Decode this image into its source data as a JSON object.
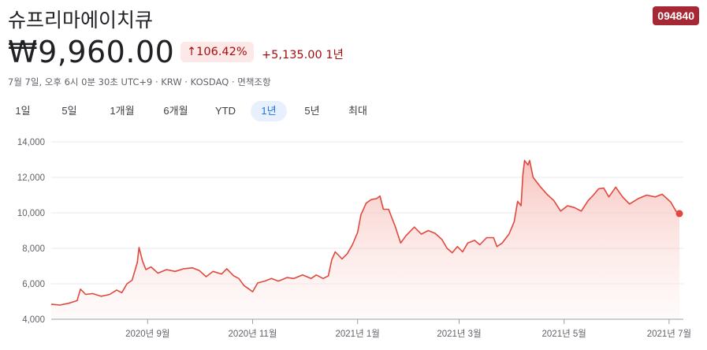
{
  "header": {
    "title": "슈프리마에이치큐",
    "ticker": "094840",
    "price": "₩9,960.00",
    "change_pct": "↑106.42%",
    "change_abs": "+5,135.00 1년",
    "meta": "7월 7일, 오후 6시 0분 30초 UTC+9 · KRW · KOSDAQ · 면책조항"
  },
  "tabs": [
    "1일",
    "5일",
    "1개월",
    "6개월",
    "YTD",
    "1년",
    "5년",
    "최대"
  ],
  "active_tab": "1년",
  "colors": {
    "line": "#e0483e",
    "fill": "#fbe3e1",
    "accent": "#1a73e8",
    "down": "#a50e0e"
  },
  "chart_data": {
    "type": "area",
    "title": "",
    "xlabel": "",
    "ylabel": "",
    "ylim": [
      4000,
      14000
    ],
    "yticks": [
      4000,
      6000,
      8000,
      10000,
      12000,
      14000
    ],
    "ytick_labels": [
      "4,000",
      "6,000",
      "8,000",
      "10,000",
      "12,000",
      "14,000"
    ],
    "xticks": [
      "2020-09-01",
      "2020-11-01",
      "2021-01-01",
      "2021-03-01",
      "2021-05-01",
      "2021-07-01"
    ],
    "xtick_labels": [
      "2020년 9월",
      "2020년 11월",
      "2021년 1월",
      "2021년 3월",
      "2021년 5월",
      "2021년 7월"
    ],
    "x_range": [
      "2020-07-07",
      "2021-07-07"
    ],
    "grid": true,
    "series": [
      {
        "name": "",
        "points": [
          [
            "2020-07-07",
            4850
          ],
          [
            "2020-07-12",
            4800
          ],
          [
            "2020-07-17",
            4900
          ],
          [
            "2020-07-22",
            5050
          ],
          [
            "2020-07-24",
            5700
          ],
          [
            "2020-07-27",
            5400
          ],
          [
            "2020-07-31",
            5450
          ],
          [
            "2020-08-05",
            5300
          ],
          [
            "2020-08-10",
            5400
          ],
          [
            "2020-08-14",
            5650
          ],
          [
            "2020-08-17",
            5500
          ],
          [
            "2020-08-20",
            6000
          ],
          [
            "2020-08-23",
            6200
          ],
          [
            "2020-08-26",
            7200
          ],
          [
            "2020-08-27",
            8050
          ],
          [
            "2020-08-29",
            7300
          ],
          [
            "2020-08-31",
            6800
          ],
          [
            "2020-09-03",
            6950
          ],
          [
            "2020-09-07",
            6600
          ],
          [
            "2020-09-12",
            6800
          ],
          [
            "2020-09-17",
            6700
          ],
          [
            "2020-09-22",
            6850
          ],
          [
            "2020-09-27",
            6900
          ],
          [
            "2020-10-01",
            6750
          ],
          [
            "2020-10-05",
            6400
          ],
          [
            "2020-10-09",
            6700
          ],
          [
            "2020-10-14",
            6550
          ],
          [
            "2020-10-17",
            6850
          ],
          [
            "2020-10-21",
            6450
          ],
          [
            "2020-10-24",
            6300
          ],
          [
            "2020-10-27",
            5900
          ],
          [
            "2020-10-30",
            5700
          ],
          [
            "2020-11-01",
            5550
          ],
          [
            "2020-11-04",
            6050
          ],
          [
            "2020-11-08",
            6150
          ],
          [
            "2020-11-12",
            6300
          ],
          [
            "2020-11-16",
            6150
          ],
          [
            "2020-11-21",
            6350
          ],
          [
            "2020-11-25",
            6300
          ],
          [
            "2020-11-30",
            6500
          ],
          [
            "2020-12-05",
            6300
          ],
          [
            "2020-12-08",
            6500
          ],
          [
            "2020-12-12",
            6300
          ],
          [
            "2020-12-15",
            6450
          ],
          [
            "2020-12-17",
            7350
          ],
          [
            "2020-12-19",
            7800
          ],
          [
            "2020-12-21",
            7600
          ],
          [
            "2020-12-23",
            7400
          ],
          [
            "2020-12-26",
            7700
          ],
          [
            "2020-12-29",
            8200
          ],
          [
            "2021-01-01",
            8900
          ],
          [
            "2021-01-03",
            9900
          ],
          [
            "2021-01-06",
            10550
          ],
          [
            "2021-01-09",
            10750
          ],
          [
            "2021-01-12",
            10800
          ],
          [
            "2021-01-14",
            10950
          ],
          [
            "2021-01-16",
            10200
          ],
          [
            "2021-01-19",
            10200
          ],
          [
            "2021-01-23",
            9200
          ],
          [
            "2021-01-26",
            8300
          ],
          [
            "2021-01-29",
            8700
          ],
          [
            "2021-02-03",
            9200
          ],
          [
            "2021-02-07",
            8800
          ],
          [
            "2021-02-11",
            9000
          ],
          [
            "2021-02-15",
            8850
          ],
          [
            "2021-02-19",
            8500
          ],
          [
            "2021-02-22",
            8000
          ],
          [
            "2021-02-25",
            7750
          ],
          [
            "2021-02-28",
            8100
          ],
          [
            "2021-03-03",
            7800
          ],
          [
            "2021-03-06",
            8300
          ],
          [
            "2021-03-10",
            8450
          ],
          [
            "2021-03-13",
            8200
          ],
          [
            "2021-03-17",
            8600
          ],
          [
            "2021-03-21",
            8600
          ],
          [
            "2021-03-23",
            8100
          ],
          [
            "2021-03-26",
            8300
          ],
          [
            "2021-03-30",
            8800
          ],
          [
            "2021-04-02",
            9500
          ],
          [
            "2021-04-04",
            10650
          ],
          [
            "2021-04-06",
            10400
          ],
          [
            "2021-04-07",
            12100
          ],
          [
            "2021-04-08",
            12950
          ],
          [
            "2021-04-10",
            12700
          ],
          [
            "2021-04-11",
            12950
          ],
          [
            "2021-04-13",
            12000
          ],
          [
            "2021-04-17",
            11500
          ],
          [
            "2021-04-21",
            11050
          ],
          [
            "2021-04-25",
            10700
          ],
          [
            "2021-04-29",
            10100
          ],
          [
            "2021-05-03",
            10400
          ],
          [
            "2021-05-07",
            10300
          ],
          [
            "2021-05-11",
            10100
          ],
          [
            "2021-05-15",
            10700
          ],
          [
            "2021-05-18",
            11000
          ],
          [
            "2021-05-21",
            11350
          ],
          [
            "2021-05-24",
            11400
          ],
          [
            "2021-05-27",
            10900
          ],
          [
            "2021-05-31",
            11450
          ],
          [
            "2021-06-04",
            10900
          ],
          [
            "2021-06-08",
            10500
          ],
          [
            "2021-06-13",
            10800
          ],
          [
            "2021-06-18",
            11000
          ],
          [
            "2021-06-23",
            10900
          ],
          [
            "2021-06-27",
            11050
          ],
          [
            "2021-07-02",
            10600
          ],
          [
            "2021-07-05",
            10100
          ],
          [
            "2021-07-07",
            9960
          ]
        ]
      }
    ]
  }
}
